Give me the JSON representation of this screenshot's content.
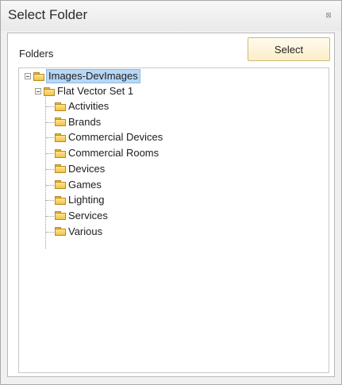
{
  "window": {
    "title": "Select Folder",
    "close_glyph": "⊠"
  },
  "panel": {
    "folders_label": "Folders",
    "select_button_label": "Select"
  },
  "tree": {
    "root": {
      "label": "Images-DevImages",
      "selected": true,
      "expanded": true
    },
    "child": {
      "label": "Flat Vector Set 1",
      "expanded": true
    },
    "leaves": [
      "Activities",
      "Brands",
      "Commercial Devices",
      "Commercial Rooms",
      "Devices",
      "Games",
      "Lighting",
      "Services",
      "Various"
    ]
  },
  "icons": {
    "folder": "folder-icon",
    "expander": "collapse-icon",
    "close": "close-icon"
  },
  "colors": {
    "selection": "#b7d7f6",
    "button_bg": "#fbeec6",
    "folder": "#f2c24c"
  }
}
